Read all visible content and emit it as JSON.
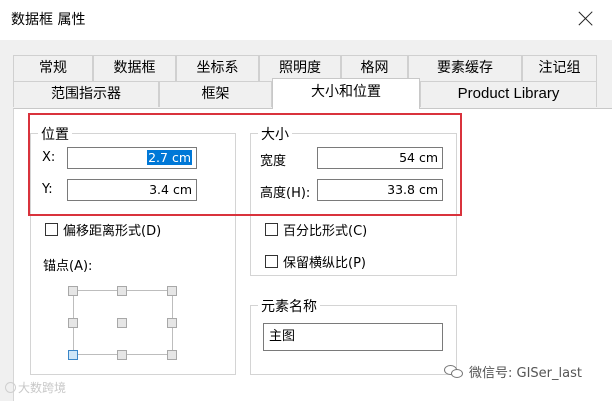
{
  "window": {
    "title": "数据框 属性",
    "close_icon": "close-icon"
  },
  "tabs_row1": [
    "常规",
    "数据框",
    "坐标系",
    "照明度",
    "格网",
    "要素缓存",
    "注记组"
  ],
  "tabs_row2": [
    "范围指示器",
    "框架",
    "大小和位置",
    "Product Library"
  ],
  "active_tab": "大小和位置",
  "position": {
    "legend": "位置",
    "x_label": "X:",
    "x_value": "2.7 cm",
    "y_label": "Y:",
    "y_value": "3.4 cm",
    "offset_checkbox": "偏移距离形式(D)",
    "anchor_label": "锚点(A):",
    "anchor_selected": "bottom-left"
  },
  "size": {
    "legend": "大小",
    "width_label": "宽度",
    "width_value": "54 cm",
    "height_label": "高度(H):",
    "height_value": "33.8 cm",
    "percent_checkbox": "百分比形式(C)",
    "aspect_checkbox": "保留横纵比(P)"
  },
  "element_name": {
    "legend": "元素名称",
    "value": "主图"
  },
  "watermark": {
    "left": "大数跨境",
    "right": "微信号: GISer_last"
  },
  "colors": {
    "highlight_box": "#d9323c",
    "selection": "#0078d7"
  }
}
